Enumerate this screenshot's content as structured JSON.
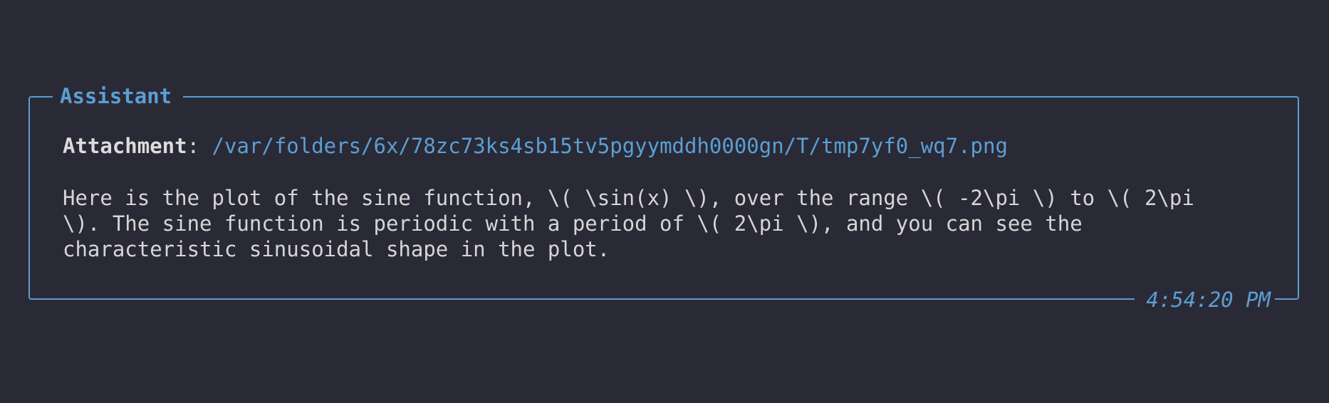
{
  "panel": {
    "title": "Assistant",
    "timestamp": "4:54:20 PM",
    "border_color": "#5c9ed3",
    "background": "#292a36"
  },
  "attachment": {
    "label": "Attachment",
    "separator": ": ",
    "path": "/var/folders/6x/78zc73ks4sb15tv5pgyymddh0000gn/T/tmp7yf0_wq7.png"
  },
  "message": {
    "lines": [
      "Here is the plot of the sine function, \\( \\sin(x) \\), over the range \\( -2\\pi \\) to \\( 2\\pi",
      "\\). The sine function is periodic with a period of \\( 2\\pi \\), and you can see the",
      "characteristic sinusoidal shape in the plot."
    ]
  }
}
